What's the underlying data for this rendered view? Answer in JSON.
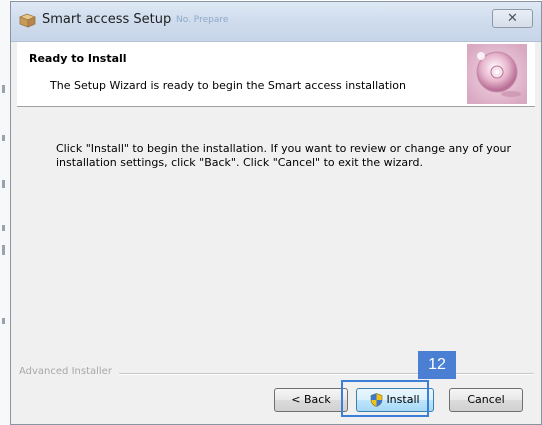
{
  "window": {
    "title": "Smart access Setup",
    "ghost_title": "No. Prepare",
    "close_symbol": "✕"
  },
  "header": {
    "title": "Ready to Install",
    "subtitle": "The Setup Wizard is ready to begin the Smart access installation",
    "graphic_icon": "installer-disc-graphic"
  },
  "body": {
    "line1": "Click \"Install\" to begin the installation.  If you want to review or change any of your",
    "line2": "installation settings, click \"Back\".  Click \"Cancel\" to exit the wizard."
  },
  "footer": {
    "brand": "Advanced Installer",
    "back_label": "< Back",
    "install_label": "Install",
    "cancel_label": "Cancel",
    "step_badge": "12"
  },
  "colors": {
    "badge": "#4a7fd4",
    "highlight": "#3b7fd6",
    "titlebar": "#cfdced"
  }
}
